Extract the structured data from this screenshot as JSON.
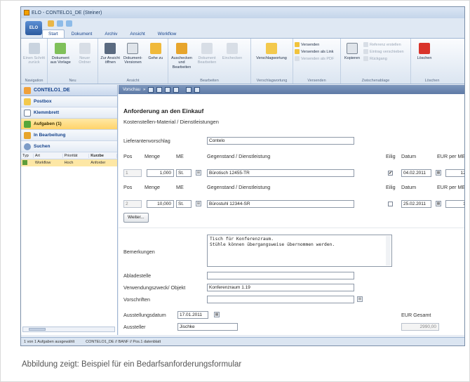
{
  "window": {
    "title": "ELO - CONTELO1_DE (Steiner)",
    "orb_label": "ELO"
  },
  "menu_tabs": [
    "Start",
    "Dokument",
    "Archiv",
    "Ansicht",
    "Workflow"
  ],
  "ribbon": {
    "groups": [
      {
        "label": "Navigation",
        "buttons": [
          "Einen Schritt zurück"
        ]
      },
      {
        "label": "Neu",
        "buttons": [
          "Dokument aus Vorlage",
          "Neuer Ordner"
        ]
      },
      {
        "label": "Ansicht",
        "buttons": [
          "Zur Ansicht öffnen",
          "Dokument-Versionen",
          "Gehe zu"
        ]
      },
      {
        "label": "Bearbeiten",
        "buttons": [
          "Auschecken und Bearbeiten",
          "Dokument Bearbeiten",
          "Einchecken"
        ]
      },
      {
        "label": "Verschlagwortung",
        "buttons": [
          "Verschlagwortung"
        ]
      },
      {
        "label": "Versenden",
        "buttons": [
          "Versenden",
          "Versenden als Link",
          "Versenden als PDF"
        ]
      },
      {
        "label": "Zwischenablage",
        "buttons": [
          "Kopieren",
          "Referenz erstellen",
          "Eintrag verschieben",
          "Rückgang"
        ]
      },
      {
        "label": "Löschen",
        "buttons": [
          "Löschen"
        ]
      }
    ]
  },
  "left_nav": {
    "header": "CONTELO1_DE",
    "items": [
      "Postbox",
      "Klemmbrett",
      "Aufgaben (1)",
      "In Bearbeitung",
      "Suchen"
    ],
    "list_columns": [
      "Typ",
      "Art",
      "Priorität",
      "Kurzbe"
    ],
    "list_rows": [
      {
        "art": "Workflow",
        "priority": "Hoch",
        "short": "Anforder"
      }
    ]
  },
  "main_toolbar": {
    "vorschau": "Vorschau"
  },
  "form": {
    "title": "Anforderung an den Einkauf",
    "subtitle": "Kostenstellen-Material / Dienstleistungen",
    "lieferant_label": "Lieferantenvorschlag",
    "lieferant_value": "Contelo",
    "col_pos": "Pos",
    "col_menge": "Menge",
    "col_me": "ME",
    "col_gegenstand": "Gegenstand / Dienstleistung",
    "col_eilig": "Eilig",
    "col_datum": "Datum",
    "col_eur": "EUR per ME",
    "positions": [
      {
        "pos": "1",
        "menge": "1,000",
        "me": "St.",
        "gegenstand": "Bürotisch 12455-TR",
        "eilig": true,
        "datum": "04.02.2011",
        "eur": "1200"
      },
      {
        "pos": "2",
        "menge": "10,000",
        "me": "St.",
        "gegenstand": "Bürostuhl 12344-SR",
        "eilig": false,
        "datum": "25.02.2011",
        "eur": "179"
      }
    ],
    "weiter_button": "Weiter...",
    "bemerkungen_label": "Bemerkungen",
    "bemerkungen_text": "Tisch für Konferenzraum.\nStühle können übergangsweise übernommen werden.",
    "abladestelle_label": "Abladestelle",
    "abladestelle_value": "",
    "verwendung_label": "Verwendungszweck/ Objekt",
    "verwendung_value": "Konferenzraum 1.19",
    "vorschriften_label": "Vorschriften",
    "vorschriften_value": "",
    "ausstellungsdatum_label": "Ausstellungsdatum",
    "ausstellungsdatum_value": "17.01.2011",
    "aussteller_label": "Aussteller",
    "aussteller_value": "Jischke",
    "eur_gesamt_label": "EUR Gesamt",
    "eur_gesamt_value": "2990,00"
  },
  "status": {
    "selection": "1 von 1 Aufgaben ausgewählt",
    "path": "CONTELO1_DE // BANF // Pos.1 datenblatt"
  },
  "caption": "Abbildung zeigt: Beispiel für ein Bedarfsanforderungsformular",
  "colors": {
    "accent": "#15428b",
    "selected_task": "#ffd36a",
    "titlebar": "#c4d5ea"
  }
}
